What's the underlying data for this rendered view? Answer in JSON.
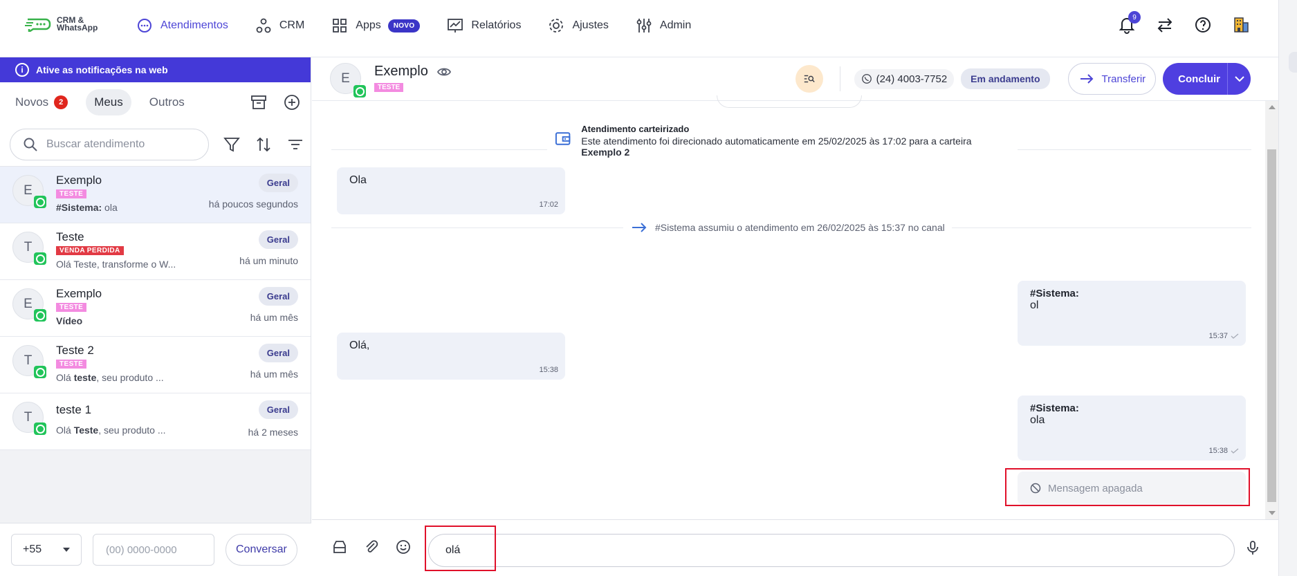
{
  "brand": {
    "logo_text": "CRM & WhatsApp"
  },
  "nav": {
    "items": [
      {
        "label": "Atendimentos"
      },
      {
        "label": "CRM"
      },
      {
        "label": "Apps",
        "badge": "NOVO"
      },
      {
        "label": "Relatórios"
      },
      {
        "label": "Ajustes"
      },
      {
        "label": "Admin"
      }
    ],
    "notifications_count": "9"
  },
  "left": {
    "notify_text": "Ative as notificações na web",
    "tabs": [
      {
        "label": "Novos",
        "count": "2"
      },
      {
        "label": "Meus"
      },
      {
        "label": "Outros"
      }
    ],
    "search_placeholder": "Buscar atendimento",
    "conversations": [
      {
        "initial": "E",
        "name": "Exemplo",
        "tag": "TESTE",
        "preview_bold": "#Sistema:",
        "preview_rest": " ola",
        "pill": "Geral",
        "time": "há poucos segundos"
      },
      {
        "initial": "T",
        "name": "Teste",
        "tag": "VENDA PERDIDA",
        "preview_bold": "",
        "preview_rest": "Olá Teste, transforme o W...",
        "pill": "Geral",
        "time": "há um minuto"
      },
      {
        "initial": "E",
        "name": "Exemplo",
        "tag": "TESTE",
        "preview_bold": "Vídeo",
        "preview_rest": "",
        "pill": "Geral",
        "time": "há um mês"
      },
      {
        "initial": "T",
        "name": "Teste 2",
        "tag": "TESTE",
        "preview_pre": "Olá ",
        "preview_bold": "teste",
        "preview_rest": ", seu produto ...",
        "pill": "Geral",
        "time": "há um mês"
      },
      {
        "initial": "T",
        "name": "teste 1",
        "tag": "",
        "preview_pre": "Olá ",
        "preview_bold": "Teste",
        "preview_rest": ", seu produto ...",
        "pill": "Geral",
        "time": "há 2 meses"
      }
    ],
    "footer": {
      "ddi": "+55",
      "phone_placeholder": "(00) 0000-0000",
      "button": "Conversar"
    }
  },
  "chat": {
    "contact_initial": "E",
    "contact_name": "Exemplo",
    "contact_tag": "TESTE",
    "phone": "(24) 4003-7752",
    "status": "Em andamento",
    "transfer_label": "Transferir",
    "conclude_label": "Concluir",
    "carteira_title": "Atendimento carteirizado",
    "carteira_text": "Este atendimento foi direcionado automaticamente em 25/02/2025 às 17:02 para a carteira ",
    "carteira_bold": "Exemplo 2",
    "assumiu_text": "#Sistema assumiu o atendimento em 26/02/2025 às 15:37 no canal",
    "messages": [
      {
        "text": "Ola",
        "time": "17:02"
      },
      {
        "sender": "#Sistema:",
        "text": "ol",
        "time": "15:37"
      },
      {
        "text": "Olá,",
        "time": "15:38"
      },
      {
        "sender": "#Sistema:",
        "text": "ola",
        "time": "15:38"
      }
    ],
    "deleted_text": "Mensagem apagada",
    "composer_value": "olá"
  },
  "colors": {
    "accent": "#4d45d6",
    "notify_bar": "#4439d8",
    "highlight": "#e0102a"
  }
}
